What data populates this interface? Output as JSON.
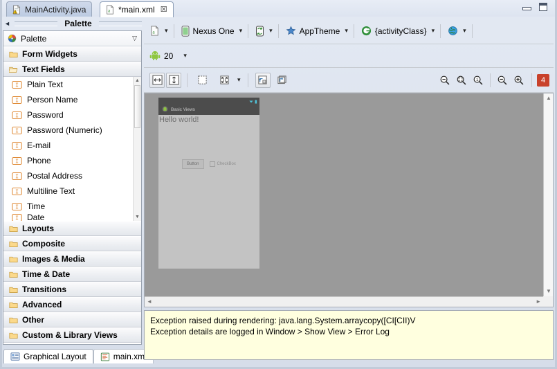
{
  "window": {
    "minimize_label": "minimize",
    "maximize_label": "maximize"
  },
  "editor_tabs": [
    {
      "label": "MainActivity.java",
      "icon": "java-file-icon",
      "active": false,
      "closable": false
    },
    {
      "label": "*main.xml",
      "icon": "xml-layout-file-icon",
      "active": true,
      "closable": true,
      "close_glyph": "☒"
    }
  ],
  "palette": {
    "view_title": "Palette",
    "combo_label": "Palette",
    "combo_caret": "▽",
    "collapse_arrow": "◄",
    "categories": [
      {
        "label": "Form Widgets",
        "icon": "folder-closed-icon",
        "expanded": false
      },
      {
        "label": "Text Fields",
        "icon": "folder-open-icon",
        "expanded": true
      },
      {
        "label": "Layouts",
        "icon": "folder-closed-icon",
        "expanded": false
      },
      {
        "label": "Composite",
        "icon": "folder-closed-icon",
        "expanded": false
      },
      {
        "label": "Images & Media",
        "icon": "folder-closed-icon",
        "expanded": false
      },
      {
        "label": "Time & Date",
        "icon": "folder-closed-icon",
        "expanded": false
      },
      {
        "label": "Transitions",
        "icon": "folder-closed-icon",
        "expanded": false
      },
      {
        "label": "Advanced",
        "icon": "folder-closed-icon",
        "expanded": false
      },
      {
        "label": "Other",
        "icon": "folder-closed-icon",
        "expanded": false
      },
      {
        "label": "Custom & Library Views",
        "icon": "folder-closed-icon",
        "expanded": false
      }
    ],
    "text_field_items": [
      {
        "label": "Plain Text",
        "icon": "text-field-icon"
      },
      {
        "label": "Person Name",
        "icon": "text-field-icon"
      },
      {
        "label": "Password",
        "icon": "text-field-icon"
      },
      {
        "label": "Password (Numeric)",
        "icon": "text-field-icon"
      },
      {
        "label": "E-mail",
        "icon": "text-field-icon"
      },
      {
        "label": "Phone",
        "icon": "text-field-icon"
      },
      {
        "label": "Postal Address",
        "icon": "text-field-icon"
      },
      {
        "label": "Multiline Text",
        "icon": "text-field-icon"
      },
      {
        "label": "Time",
        "icon": "text-field-icon"
      },
      {
        "label": "Date",
        "icon": "text-field-icon"
      }
    ],
    "scroll_up_glyph": "▲",
    "scroll_down_glyph": "▼"
  },
  "config_toolbar": {
    "config_chooser": {
      "label": "",
      "icon": "xml-layout-file-icon",
      "caret": "▾"
    },
    "device": {
      "label": "Nexus One",
      "icon": "device-phone-icon",
      "caret": "▾"
    },
    "orientation": {
      "label": "",
      "icon": "orientation-portrait-icon",
      "caret": "▾"
    },
    "theme": {
      "label": "AppTheme",
      "icon": "theme-star-icon",
      "caret": "▾"
    },
    "activity": {
      "label": "{activityClass}",
      "icon": "activity-class-icon",
      "caret": "▾"
    },
    "locale": {
      "label": "",
      "icon": "globe-locale-icon",
      "caret": "▾"
    },
    "api_level": {
      "label": "20",
      "icon": "android-robot-icon",
      "caret": "▾"
    }
  },
  "layout_toolbar": {
    "buttons": [
      {
        "name": "toggle-width-fill",
        "icon": "arrows-horizontal-icon",
        "toggled": true
      },
      {
        "name": "toggle-height-fill",
        "icon": "arrows-vertical-icon",
        "toggled": true
      },
      {
        "name": "show-outlines",
        "icon": "dotted-rect-icon",
        "toggled": false
      },
      {
        "name": "distribute",
        "icon": "expand-arrows-icon",
        "toggled": false
      },
      {
        "name": "refresh-layout",
        "icon": "refresh-render-icon",
        "toggled": true
      },
      {
        "name": "include-in",
        "icon": "include-layout-icon",
        "toggled": false
      }
    ],
    "distribute_caret": "▾",
    "zoom_buttons": [
      {
        "name": "zoom-fit",
        "icon": "zoom-out-fit-icon"
      },
      {
        "name": "zoom-to-fit",
        "icon": "zoom-fit-icon"
      },
      {
        "name": "zoom-100",
        "icon": "zoom-actual-size-icon"
      },
      {
        "name": "zoom-out",
        "icon": "zoom-minus-icon"
      },
      {
        "name": "zoom-in",
        "icon": "zoom-plus-icon"
      }
    ],
    "error_badge": "4"
  },
  "preview": {
    "app_title": "Basic Views",
    "hello_text": "Hello world!",
    "button_label": "Button",
    "checkbox_label": "CheckBox",
    "statusbar_icons": [
      "wifi-icon",
      "battery-icon"
    ],
    "app_icon": "android-app-icon"
  },
  "scrollbars": {
    "up_glyph": "▲",
    "down_glyph": "▼",
    "left_glyph": "◄",
    "right_glyph": "►"
  },
  "error_panel": {
    "line1": "Exception raised during rendering: java.lang.System.arraycopy([CI[CII)V",
    "line2": "Exception details are logged in Window > Show View > Error Log",
    "background": "#ffffdf"
  },
  "bottom_tabs": [
    {
      "label": "Graphical Layout",
      "icon": "graphical-layout-icon",
      "active": true
    },
    {
      "label": "main.xml",
      "icon": "xml-source-icon",
      "active": false
    }
  ],
  "colors": {
    "badge_red": "#c8412b",
    "canvas_gray": "#9a9a9a",
    "device_chrome": "#4c4c4c"
  }
}
